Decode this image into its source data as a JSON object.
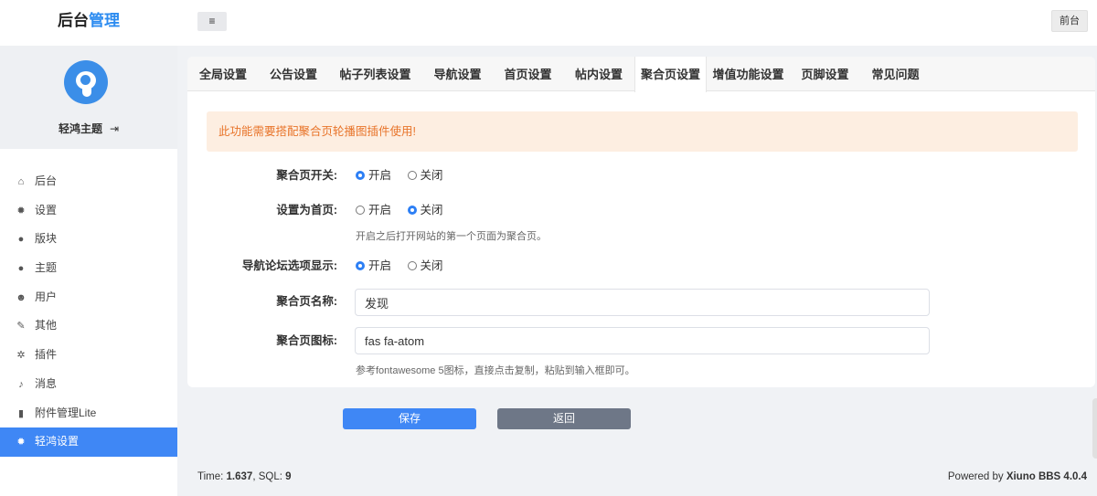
{
  "header": {
    "brand_prefix": "后台",
    "brand_accent": "管理",
    "menu_toggle_icon": "≡",
    "front_link": "前台"
  },
  "profile": {
    "name": "轻鸿主题",
    "logout_icon": "⇥"
  },
  "sidebar": {
    "items": [
      {
        "label": "后台",
        "icon": "home-icon",
        "glyph": "⌂"
      },
      {
        "label": "设置",
        "icon": "gear-icon",
        "glyph": "✹"
      },
      {
        "label": "版块",
        "icon": "comment-icon",
        "glyph": "●"
      },
      {
        "label": "主题",
        "icon": "comment-icon",
        "glyph": "●"
      },
      {
        "label": "用户",
        "icon": "user-icon",
        "glyph": "☻"
      },
      {
        "label": "其他",
        "icon": "wrench-icon",
        "glyph": "✎"
      },
      {
        "label": "插件",
        "icon": "cogs-icon",
        "glyph": "✲"
      },
      {
        "label": "消息",
        "icon": "bell-icon",
        "glyph": "♪"
      },
      {
        "label": "附件管理Lite",
        "icon": "file-icon",
        "glyph": "▮"
      },
      {
        "label": "轻鸿设置",
        "icon": "gear-icon",
        "glyph": "✹"
      }
    ],
    "active_index": 9
  },
  "tabs": [
    "全局设置",
    "公告设置",
    "帖子列表设置",
    "导航设置",
    "首页设置",
    "帖内设置",
    "聚合页设置",
    "增值功能设置",
    "页脚设置",
    "常见问题"
  ],
  "active_tab": "聚合页设置",
  "alert": "此功能需要搭配聚合页轮播图插件使用!",
  "form": {
    "switch": {
      "label": "聚合页开关:",
      "on": "开启",
      "off": "关闭",
      "value": "on"
    },
    "homepage": {
      "label": "设置为首页:",
      "on": "开启",
      "off": "关闭",
      "value": "off",
      "help": "开启之后打开网站的第一个页面为聚合页。"
    },
    "nav_display": {
      "label": "导航论坛选项显示:",
      "on": "开启",
      "off": "关闭",
      "value": "on"
    },
    "name": {
      "label": "聚合页名称:",
      "value": "发现"
    },
    "icon": {
      "label": "聚合页图标:",
      "value": "fas fa-atom",
      "help": "参考fontawesome 5图标，直接点击复制，粘贴到输入框即可。"
    }
  },
  "buttons": {
    "save": "保存",
    "back": "返回"
  },
  "footer": {
    "time_label": "Time: ",
    "time_value": "1.637",
    "sql_label": ", SQL: ",
    "sql_value": "9",
    "powered_label": "Powered by ",
    "powered_value": "Xiuno BBS 4.0.4"
  }
}
